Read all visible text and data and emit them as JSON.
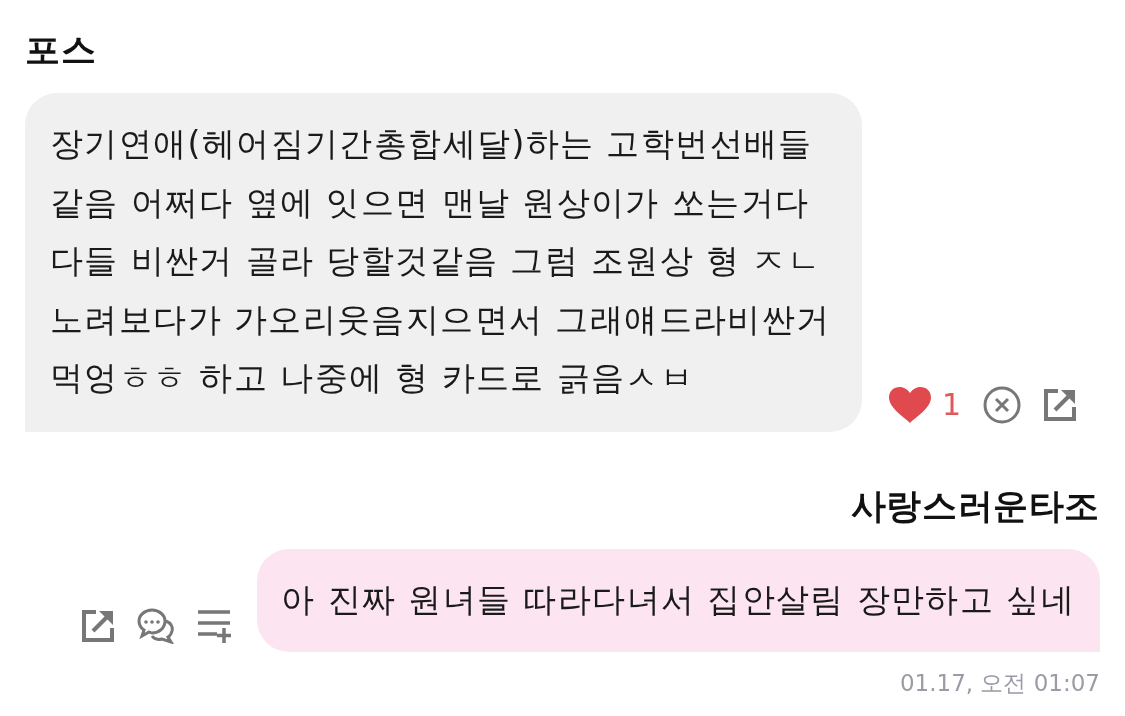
{
  "messages": [
    {
      "kind": "received",
      "sender": "포스",
      "text": "장기연애(헤어짐기간총합세달)하는 고학번선배들 같음 어쩌다 옆에 잇으면 맨날 원상이가 쏘는거다 다들 비싼거 골라 당할것같음 그럼 조원상 형 ㅈㄴ 노려보다가 가오리웃음지으면서 그래얘드라비싼거 먹엉ㅎㅎ 하고 나중에 형 카드로 긁음ㅅㅂ",
      "liked": true,
      "like_count": "1"
    },
    {
      "kind": "sent",
      "sender": "사랑스러운타조",
      "text": "아 진짜 원녀들 따라다녀서 집안살림 장만하고 싶네",
      "timestamp": "01.17, 오전 01:07"
    }
  ]
}
